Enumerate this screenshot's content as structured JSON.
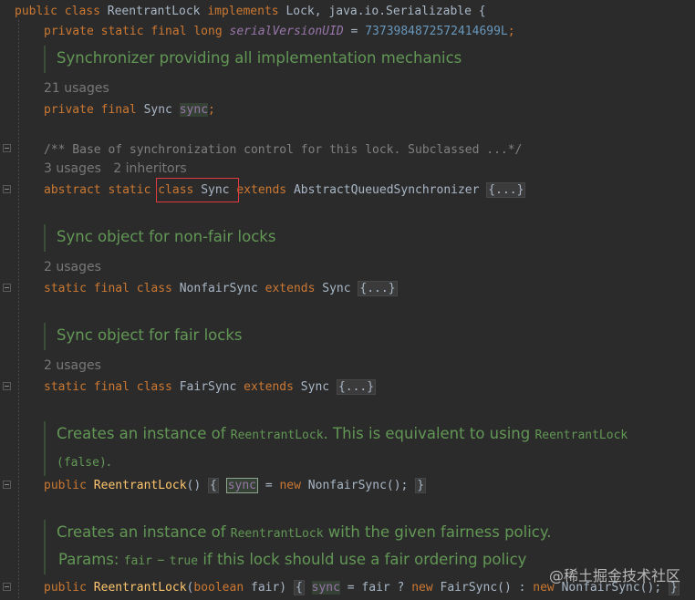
{
  "code": {
    "class_decl": {
      "public": "public",
      "class_kw": "class",
      "name": "ReentrantLock",
      "implements_kw": "implements",
      "interfaces": "Lock, java.io.Serializable {"
    },
    "serial": {
      "modifiers": "private static final long",
      "field": "serialVersionUID",
      "eq": " = ",
      "value": "7373984872572414699L",
      "semi": ";"
    },
    "doc_sync_field": "Synchronizer providing all implementation mechanics",
    "usages_sync_field": "21 usages",
    "sync_field": {
      "modifiers": "private final",
      "type": "Sync",
      "name": "sync",
      "semi": ";"
    },
    "sync_comment": "/** Base of synchronization control for this lock. Subclassed ...*/",
    "sync_class_meta": {
      "usages": "3 usages",
      "inheritors": "2 inheritors"
    },
    "sync_class": {
      "modifiers": "abstract static",
      "class_kw": "class",
      "name": "Sync",
      "extends_kw": "extends",
      "parent": "AbstractQueuedSynchronizer",
      "body": "{...}"
    },
    "doc_nonfair": "Sync object for non-fair locks",
    "usages_nonfair": "2 usages",
    "nonfair_class": {
      "modifiers": "static final",
      "class_kw": "class",
      "name": "NonfairSync",
      "extends_kw": "extends",
      "parent": "Sync",
      "body": "{...}"
    },
    "doc_fair": "Sync object for fair locks",
    "usages_fair": "2 usages",
    "fair_class": {
      "modifiers": "static final",
      "class_kw": "class",
      "name": "FairSync",
      "extends_kw": "extends",
      "parent": "Sync",
      "body": "{...}"
    },
    "doc_ctor1": {
      "pre": "Creates an instance of ",
      "code1": "ReentrantLock",
      "mid": ". This is equivalent to using ",
      "code2": "ReentrantLock",
      "code3": "(false)",
      "end": "."
    },
    "ctor1": {
      "public": "public",
      "name": "ReentrantLock",
      "parens": "()",
      "open": "{",
      "field": "sync",
      "eq": " = ",
      "new_kw": "new",
      "expr": "NonfairSync();",
      "close": "}"
    },
    "doc_ctor2": {
      "pre": "Creates an instance of ",
      "code1": "ReentrantLock",
      "post": " with the given fairness policy.",
      "params_label": "Params: ",
      "param_name": "fair",
      "dash": " – ",
      "true_code": "true",
      "param_desc": " if this lock should use a fair ordering policy"
    },
    "ctor2": {
      "public": "public",
      "name": "ReentrantLock",
      "open_paren": "(",
      "param_type": "boolean",
      "param_name": " fair)",
      "open": "{",
      "field": "sync",
      "eq": " = fair ? ",
      "new_kw1": "new",
      "fair_expr": "FairSync() : ",
      "new_kw2": "new",
      "nonfair_expr": "NonfairSync();",
      "close": "}"
    }
  },
  "watermark": "@稀土掘金技术社区",
  "colors": {
    "background": "#2b2b2b",
    "keyword": "#cc7832",
    "text": "#a9b7c6",
    "field": "#9876aa",
    "number": "#6897bb",
    "comment": "#808080",
    "method": "#ffc66d",
    "doc": "#629755",
    "highlight_box": "#e0393e"
  }
}
